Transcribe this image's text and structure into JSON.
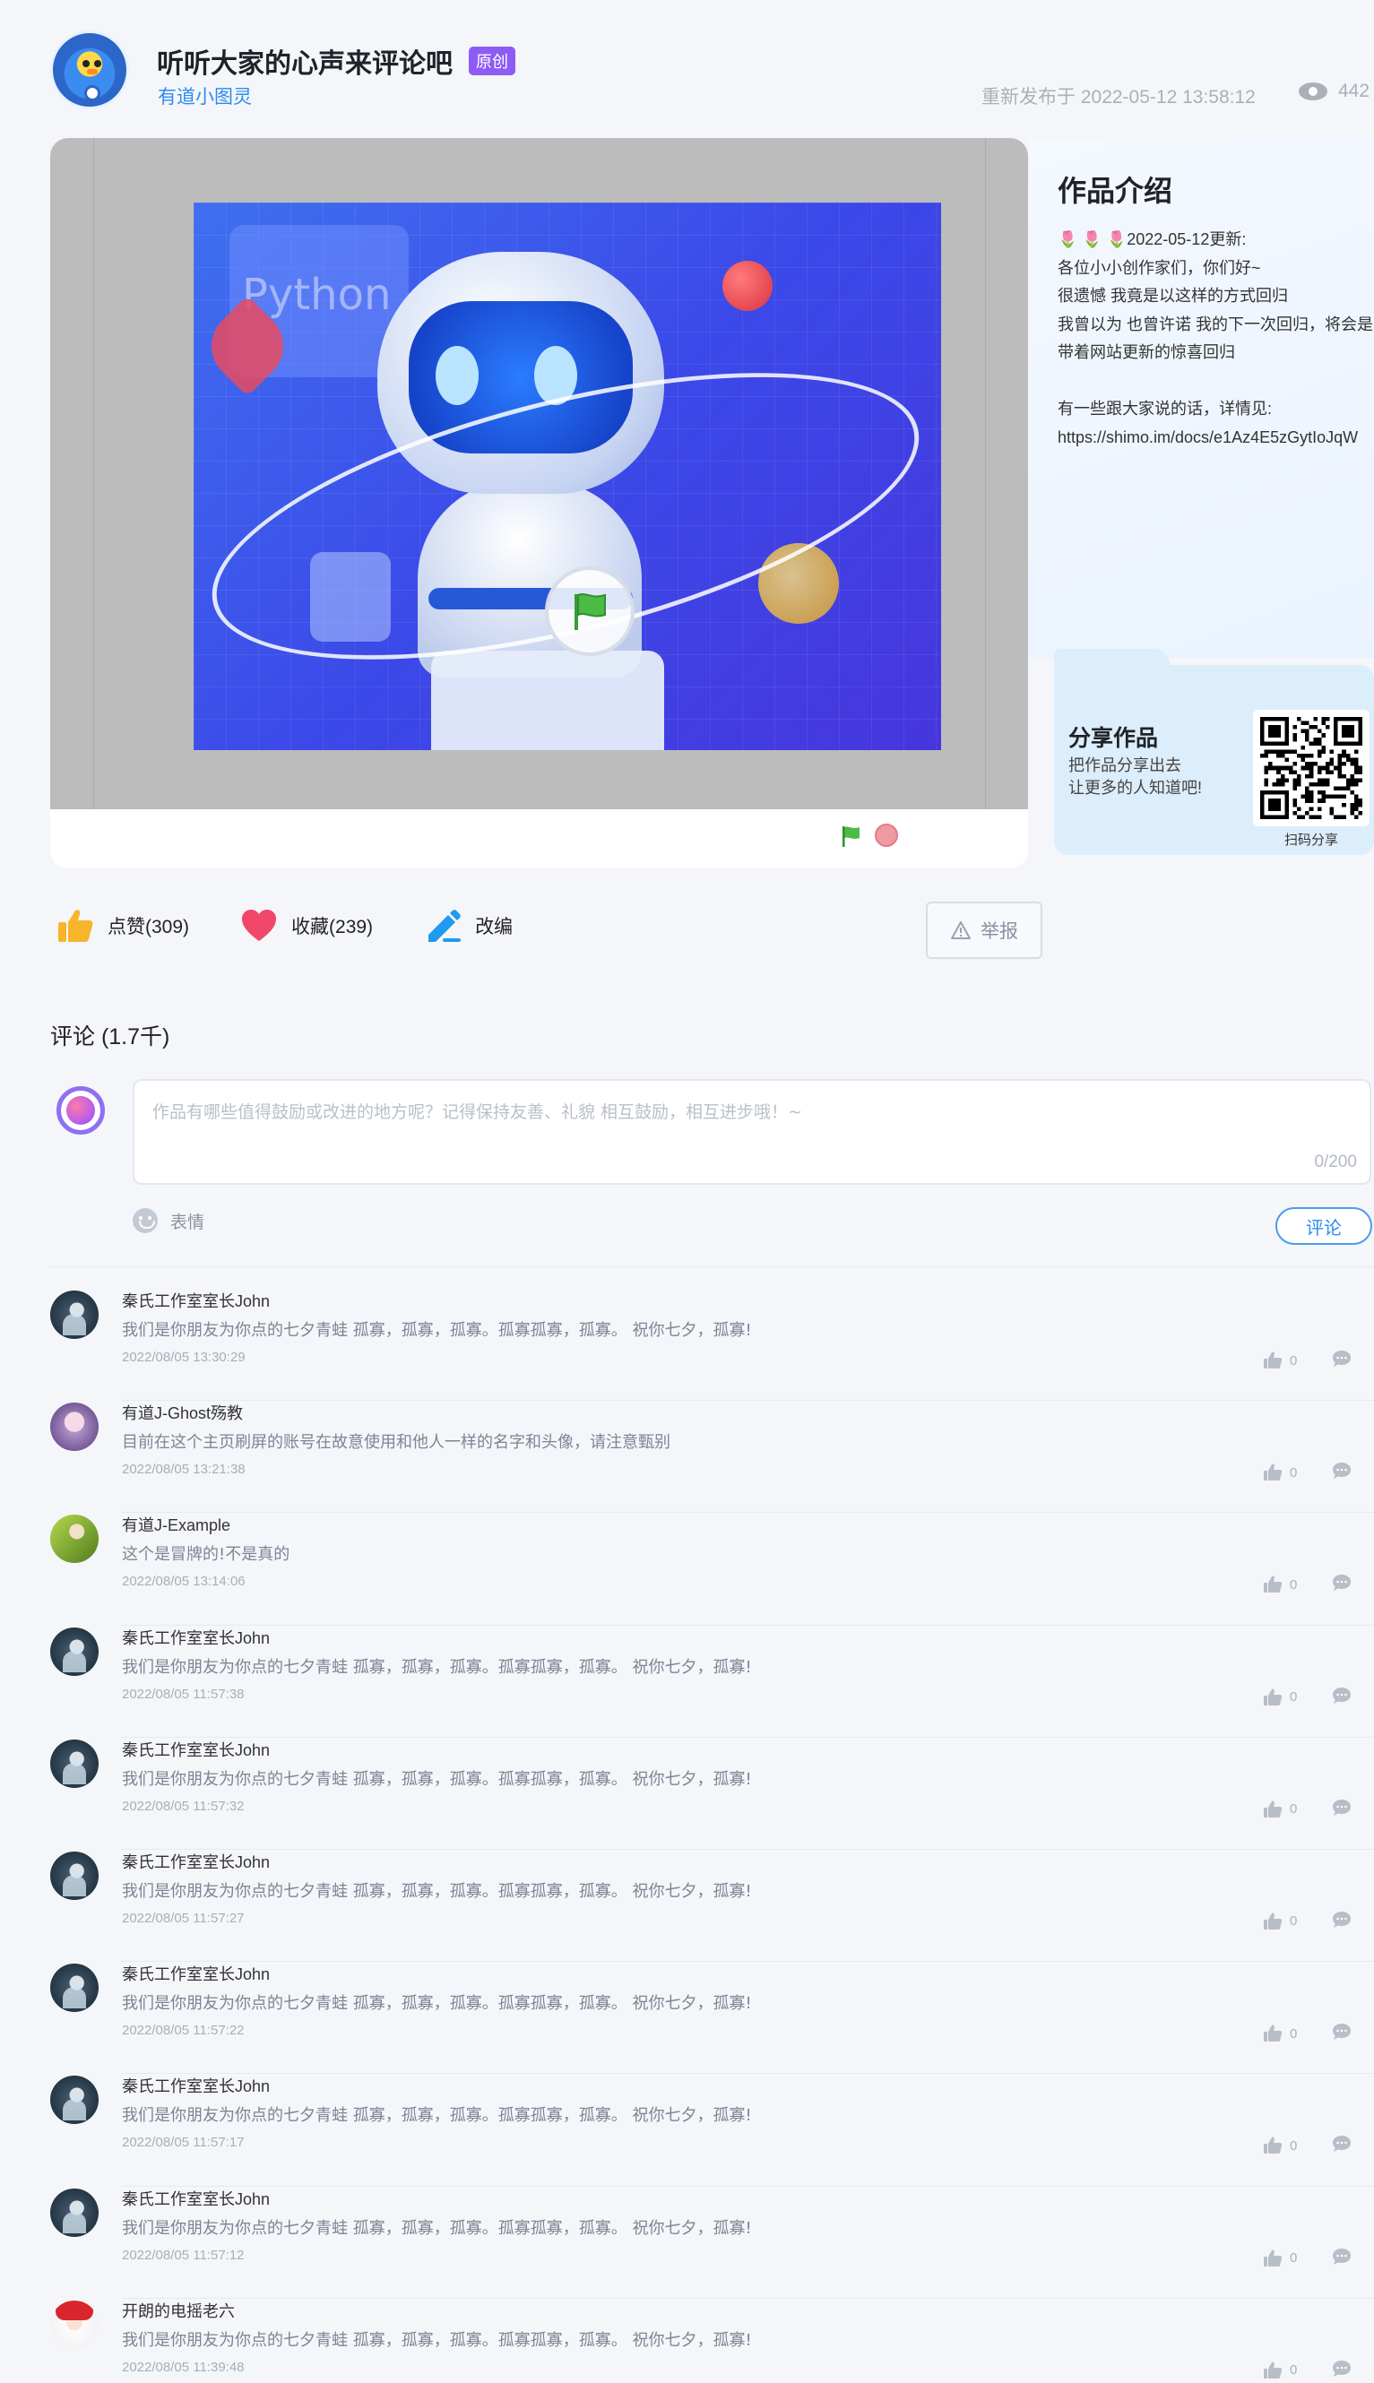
{
  "header": {
    "title": "听听大家的心声来评论吧",
    "original_tag": "原创",
    "author": "有道小图灵",
    "publish_info": "重新发布于 2022-05-12 13:58:12",
    "views": "442"
  },
  "cover": {
    "python_text": "Python"
  },
  "intro": {
    "title": "作品介绍",
    "lines": [
      "2022-05-12更新:",
      "各位小小创作家们，你们好~",
      "很遗憾 我竟是以这样的方式回归",
      "我曾以为 也曾许诺 我的下一次回归，将会是",
      "带着网站更新的惊喜回归",
      "",
      "有一些跟大家说的话，详情见:",
      "https://shimo.im/docs/e1Az4E5zGytIoJqW"
    ],
    "tulips": "🌷 🌷 🌷"
  },
  "share": {
    "title": "分享作品",
    "line1": "把作品分享出去",
    "line2": "让更多的人知道吧!",
    "qr_label": "扫码分享"
  },
  "actions": {
    "like": "点赞(309)",
    "favorite": "收藏(239)",
    "remix": "改编",
    "report": "举报"
  },
  "comments": {
    "heading": "评论 (1.7千)",
    "placeholder": "作品有哪些值得鼓励或改进的地方呢？记得保持友善、礼貌 相互鼓励，相互进步哦！~",
    "counter": "0/200",
    "emoji_label": "表情",
    "submit_label": "评论",
    "items": [
      {
        "user": "秦氏工作室室长John",
        "text": "我们是你朋友为你点的七夕青蛙 孤寡，孤寡，孤寡。孤寡孤寡，孤寡。 祝你七夕，孤寡!",
        "time": "2022/08/05 13:30:29",
        "likes": "0",
        "avatar": "john"
      },
      {
        "user": "有道J-Ghost殇教",
        "text": "目前在这个主页刷屏的账号在故意使用和他人一样的名字和头像，请注意甄别",
        "time": "2022/08/05 13:21:38",
        "likes": "0",
        "avatar": "ghost"
      },
      {
        "user": "有道J-Example",
        "text": "这个是冒牌的!不是真的",
        "time": "2022/08/05 13:14:06",
        "likes": "0",
        "avatar": "example"
      },
      {
        "user": "秦氏工作室室长John",
        "text": "我们是你朋友为你点的七夕青蛙 孤寡，孤寡，孤寡。孤寡孤寡，孤寡。 祝你七夕，孤寡!",
        "time": "2022/08/05 11:57:38",
        "likes": "0",
        "avatar": "john"
      },
      {
        "user": "秦氏工作室室长John",
        "text": "我们是你朋友为你点的七夕青蛙 孤寡，孤寡，孤寡。孤寡孤寡，孤寡。 祝你七夕，孤寡!",
        "time": "2022/08/05 11:57:32",
        "likes": "0",
        "avatar": "john"
      },
      {
        "user": "秦氏工作室室长John",
        "text": "我们是你朋友为你点的七夕青蛙 孤寡，孤寡，孤寡。孤寡孤寡，孤寡。 祝你七夕，孤寡!",
        "time": "2022/08/05 11:57:27",
        "likes": "0",
        "avatar": "john"
      },
      {
        "user": "秦氏工作室室长John",
        "text": "我们是你朋友为你点的七夕青蛙 孤寡，孤寡，孤寡。孤寡孤寡，孤寡。 祝你七夕，孤寡!",
        "time": "2022/08/05 11:57:22",
        "likes": "0",
        "avatar": "john"
      },
      {
        "user": "秦氏工作室室长John",
        "text": "我们是你朋友为你点的七夕青蛙 孤寡，孤寡，孤寡。孤寡孤寡，孤寡。 祝你七夕，孤寡!",
        "time": "2022/08/05 11:57:17",
        "likes": "0",
        "avatar": "john"
      },
      {
        "user": "秦氏工作室室长John",
        "text": "我们是你朋友为你点的七夕青蛙 孤寡，孤寡，孤寡。孤寡孤寡，孤寡。 祝你七夕，孤寡!",
        "time": "2022/08/05 11:57:12",
        "likes": "0",
        "avatar": "john"
      },
      {
        "user": "开朗的电摇老六",
        "text": "我们是你朋友为你点的七夕青蛙 孤寡，孤寡，孤寡。孤寡孤寡，孤寡。 祝你七夕，孤寡!",
        "time": "2022/08/05 11:39:48",
        "likes": "0",
        "avatar": "liu"
      }
    ]
  },
  "colors": {
    "accent": "#2d8cf0",
    "tag": "#8d5cf6",
    "like_icon": "#f7b52c",
    "favorite_icon": "#f0476a",
    "remix_icon": "#1e9bf0"
  },
  "icons": {
    "views": "eye-icon",
    "green_flag": "green-flag-icon",
    "stop": "stop-icon",
    "like": "thumbs-up-icon",
    "favorite": "heart-icon",
    "remix": "edit-pen-icon",
    "report": "warning-icon",
    "emoji": "smiley-icon",
    "comment_like": "thumbs-up-icon",
    "comment_reply": "reply-bubble-icon"
  }
}
